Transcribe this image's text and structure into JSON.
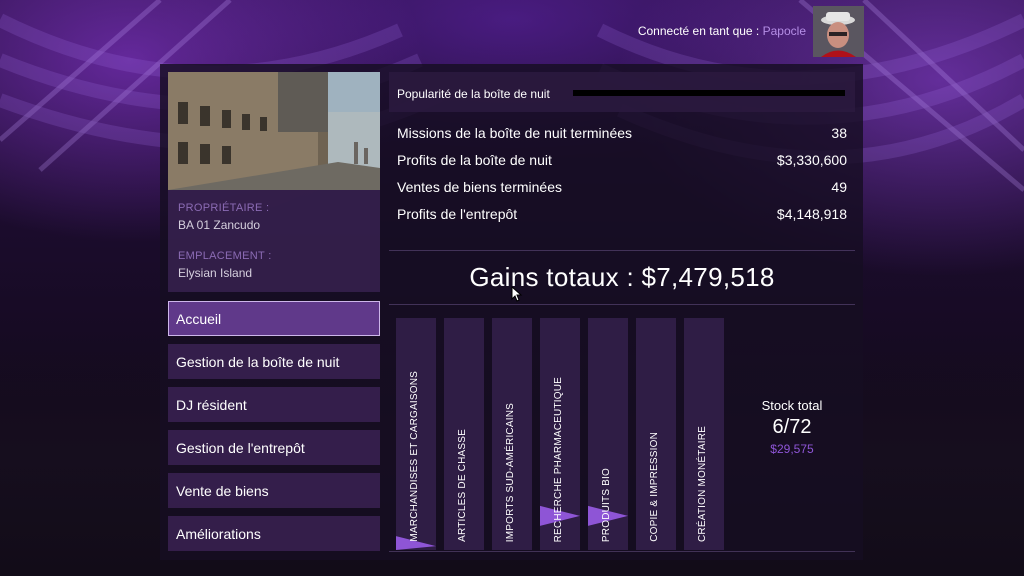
{
  "header": {
    "connected_label": "Connecté en tant que :",
    "username": "Papocle"
  },
  "property": {
    "owner_label": "PROPRIÉTAIRE :",
    "owner_value": "BA 01 Zancudo",
    "location_label": "EMPLACEMENT :",
    "location_value": "Elysian Island"
  },
  "menu": {
    "items": [
      {
        "label": "Accueil",
        "active": true
      },
      {
        "label": "Gestion de la boîte de nuit"
      },
      {
        "label": "DJ résident"
      },
      {
        "label": "Gestion de l'entrepôt"
      },
      {
        "label": "Vente de biens"
      },
      {
        "label": "Améliorations"
      }
    ]
  },
  "popularity": {
    "label": "Popularité de la boîte de nuit",
    "level": 0.0
  },
  "stats": [
    {
      "label": "Missions de la boîte de nuit terminées",
      "value": "38"
    },
    {
      "label": "Profits de la boîte de nuit",
      "value": "$3,330,600"
    },
    {
      "label": "Ventes de biens terminées",
      "value": "49"
    },
    {
      "label": "Profits de l'entrepôt",
      "value": "$4,148,918"
    }
  ],
  "total": {
    "text": "Gains totaux : $7,479,518"
  },
  "goods": [
    {
      "label": "MARCHANDISES ET CARGAISONS",
      "fill": 0.06
    },
    {
      "label": "ARTICLES DE CHASSE",
      "fill": 0.0
    },
    {
      "label": "IMPORTS SUD-AMÉRICAINS",
      "fill": 0.0
    },
    {
      "label": "RECHERCHE PHARMACEUTIQUE",
      "fill": 0.19
    },
    {
      "label": "PRODUITS BIO",
      "fill": 0.19
    },
    {
      "label": "COPIE & IMPRESSION",
      "fill": 0.0
    },
    {
      "label": "CRÉATION MONÉTAIRE",
      "fill": 0.0
    }
  ],
  "stock": {
    "label": "Stock total",
    "count": "6/72",
    "value": "$29,575"
  },
  "colors": {
    "accent": "#8e55d6",
    "panel": "#2c1a40",
    "menu_active": "#683e96"
  }
}
